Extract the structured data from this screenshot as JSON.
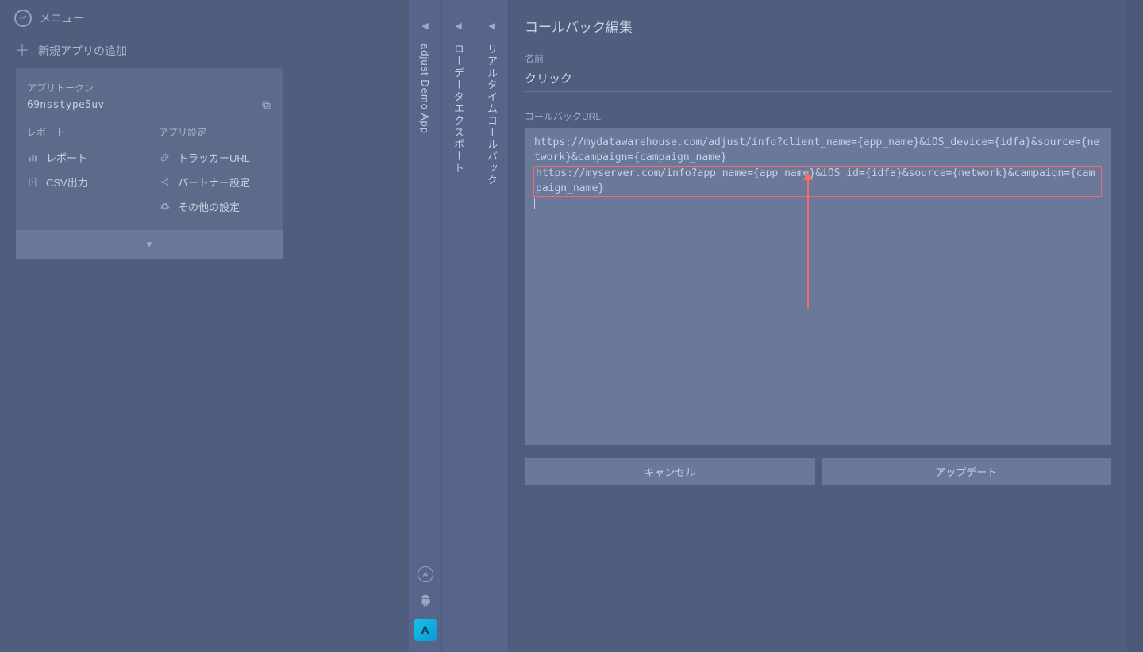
{
  "sidebar": {
    "menu_label": "メニュー",
    "add_app_label": "新規アプリの追加",
    "app_card": {
      "token_label": "アプリトークン",
      "token_value": "69nsstype5uv",
      "report_header": "レポート",
      "report_links": {
        "report": "レポート",
        "csv": "CSV出力"
      },
      "settings_header": "アプリ設定",
      "settings_links": {
        "tracker": "トラッカーURL",
        "partner": "パートナー設定",
        "other": "その他の設定"
      }
    }
  },
  "slats": {
    "app_name": "adjust Demo App",
    "export": "ローデータエクスポート",
    "realtime": "リアルタイムコールバック"
  },
  "main": {
    "title": "コールバック編集",
    "name_label": "名前",
    "name_value": "クリック",
    "url_label": "コールバックURL",
    "url_part1": "https://mydatawarehouse.com/adjust/info?client_name={app_name}&iOS_device={idfa}&source={network}&campaign={campaign_name}",
    "url_part2": "https://myserver.com/info?app_name={app_name}&iOS_id={idfa}&source={network}&campaign={campaign_name}",
    "cancel": "キャンセル",
    "update": "アップデート"
  },
  "icons": {
    "store_apple": "appstore-icon",
    "store_android": "android-icon",
    "adj": "A"
  }
}
